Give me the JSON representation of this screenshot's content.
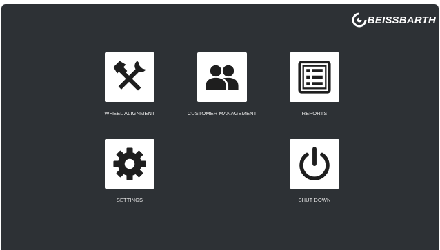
{
  "brand": {
    "logo_text": "BEISSBARTH"
  },
  "menu": {
    "wheel_alignment": {
      "label": "WHEEL ALIGNMENT",
      "icon": "wrench-hammer-icon"
    },
    "customer_management": {
      "label": "CUSTOMER MANAGEMENT",
      "icon": "users-icon"
    },
    "reports": {
      "label": "REPORTS",
      "icon": "list-document-icon"
    },
    "settings": {
      "label": "SETTINGS",
      "icon": "gear-icon"
    },
    "shut_down": {
      "label": "SHUT DOWN",
      "icon": "power-icon"
    }
  },
  "colors": {
    "background": "#2d3135",
    "tile": "#ffffff",
    "icon": "#1e1e1e",
    "label": "#e8e8e8"
  }
}
